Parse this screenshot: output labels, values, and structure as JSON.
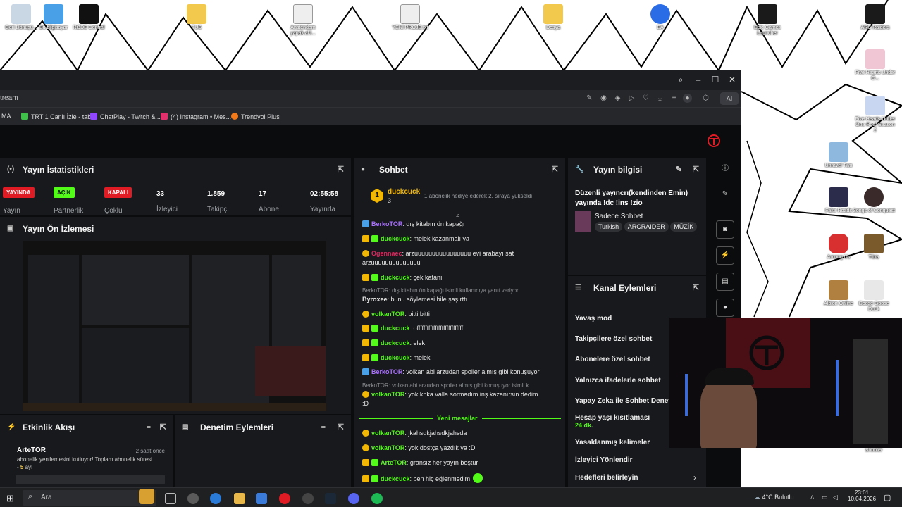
{
  "desktop": {
    "icons": [
      {
        "label": "Geri Dönüşü...",
        "color": "#c9d6e3"
      },
      {
        "label": "Bu bilgisayar",
        "color": "#4aa0e6"
      },
      {
        "label": "RØDE Central",
        "color": "#111111"
      },
      {
        "label": "TUS",
        "color": "#f2c94c"
      },
      {
        "label": "Anstendam yapak.akl...",
        "color": "#eeeeee"
      },
      {
        "label": "YENİ PROJE.txt",
        "color": "#eeeeee"
      },
      {
        "label": "Dosya",
        "color": "#f2c94c"
      },
      {
        "label": "EA",
        "color": "#2a6ce6"
      },
      {
        "label": "Epic Games Launcher",
        "color": "#1a1a1a"
      },
      {
        "label": "ARC Raiders",
        "color": "#1a1a1a"
      },
      {
        "label": "Five Hearts Under O...",
        "color": "#f1c6d4"
      },
      {
        "label": "Five Hearts Under One Roof Season 2",
        "color": "#c9d6f1"
      },
      {
        "label": "Unravel Two",
        "color": "#8fb8de"
      },
      {
        "label": "Fake Roads",
        "color": "#2b2b4b"
      },
      {
        "label": "Songs of Conquest",
        "color": "#3b2a2a"
      },
      {
        "label": "Among Us",
        "color": "#d83030"
      },
      {
        "label": "Tibia",
        "color": "#7a5a2a"
      },
      {
        "label": "Albion Online",
        "color": "#b08040"
      },
      {
        "label": "Goose Goose Duck",
        "color": "#e8e8e8"
      },
      {
        "label": "Shooter",
        "color": "#5a5a5a"
      }
    ]
  },
  "browser": {
    "url": "tream",
    "ai_label": "AI",
    "bookmarks": [
      {
        "label": "MA...",
        "color": "#888888"
      },
      {
        "label": "TRT 1 Canlı İzle - tabii",
        "color": "#3ec24a"
      },
      {
        "label": "ChatPlay - Twitch &...",
        "color": "#9146ff"
      },
      {
        "label": "(4) Instagram • Mes...",
        "color": "#e1306c"
      },
      {
        "label": "Trendyol Plus",
        "color": "#f27a1a"
      }
    ]
  },
  "stats": {
    "title": "Yayın İstatistikleri",
    "badges": [
      {
        "text": "YAYINDA",
        "bg": "#e01b24",
        "fg": "#ffffff",
        "caption": "Yayın"
      },
      {
        "text": "AÇIK",
        "bg": "#53fc18",
        "fg": "#0b0c0d",
        "caption": "Partnerlik"
      },
      {
        "text": "KAPALI",
        "bg": "#e01b24",
        "fg": "#ffffff",
        "caption": "Çoklu"
      }
    ],
    "items": [
      {
        "value": "33",
        "label": "İzleyici"
      },
      {
        "value": "1.859",
        "label": "Takipçi"
      },
      {
        "value": "17",
        "label": "Abone"
      },
      {
        "value": "02:55:58",
        "label": "Yayında"
      }
    ]
  },
  "preview": {
    "title": "Yayın Ön İzlemesi"
  },
  "activity": {
    "title": "Etkinlik Akışı",
    "item": {
      "user": "ArteTOR",
      "time": "2 saat önce",
      "text1": "abonelik yenilemesini kutluyor! Toplam abonelik süresi",
      "text2_a": "- ",
      "text2_num": "5",
      "text2_b": " ay!"
    }
  },
  "moderation": {
    "title": "Denetim Eylemleri"
  },
  "chat": {
    "title": "Sohbet",
    "pinned": {
      "user": "duckcuck",
      "count": "3",
      "text": "1 abonelik hediye ederek 2. sıraya yükseldi",
      "rank": "1"
    },
    "messages": [
      {
        "user": "BerkoTOR",
        "color": "#a970ff",
        "text": ": dış kitabın ön kapağı"
      },
      {
        "user": "duckcuck",
        "color": "#53fc18",
        "text": ": melek kazanmalı ya"
      },
      {
        "user": "Ogennaec",
        "color": "#e0245e",
        "text": ": arzuuuuuuuuuuuuuuuu evi arabayı sat"
      },
      {
        "user": "",
        "color": "#e8e8e8",
        "text": "arzuuuuuuuuuuuuuu"
      },
      {
        "user": "duckcuck",
        "color": "#53fc18",
        "text": ": çek kafanı"
      },
      {
        "user": "Byroxee",
        "color": "#e8e8e8",
        "text": ": bunu söylemesi bile şaşırttı"
      },
      {
        "user": "volkanTOR",
        "color": "#53fc18",
        "text": ": bitti bitti"
      },
      {
        "user": "duckcuck",
        "color": "#53fc18",
        "text": ": offffffffffffffffffffffffffff"
      },
      {
        "user": "duckcuck",
        "color": "#53fc18",
        "text": ": elek"
      },
      {
        "user": "duckcuck",
        "color": "#53fc18",
        "text": ": melek"
      },
      {
        "user": "BerkoTOR",
        "color": "#a970ff",
        "text": ": volkan abi arzudan spoiler almış gibi konuşuyor"
      },
      {
        "user": "volkanTOR",
        "color": "#53fc18",
        "text": ": yok knka valla sormadım inş kazanırsın dedim"
      },
      {
        "user": "",
        "color": "#e8e8e8",
        "text": ":D"
      },
      {
        "user": "volkanTOR",
        "color": "#53fc18",
        "text": ": jkahsdkjahsdkjahsda"
      },
      {
        "user": "volkanTOR",
        "color": "#53fc18",
        "text": ": yok dostça yazdık ya :D"
      },
      {
        "user": "ArteTOR",
        "color": "#53fc18",
        "text": ": gransız her yayın boştur"
      },
      {
        "user": "duckcuck",
        "color": "#53fc18",
        "text": ": ben hiç eğlenmedim"
      }
    ],
    "replies": [
      "BerkoTOR: dış kitabın ön kapağı isimli kullanıcıya yanıt veriyor",
      "BerkoTOR: volkan abi arzudan spoiler almış gibi konuşuyor isimli k..."
    ],
    "new_messages": "Yeni mesajlar"
  },
  "info": {
    "title": "Yayın bilgisi",
    "stream_title": "Düzenli yayıncrı(kendinden Emin)",
    "stream_title2": "yayında !dc !ins !zio",
    "category": "Sadece Sohbet",
    "tags": [
      "Turkish",
      "ARCRAIDER",
      "MÜZİK"
    ]
  },
  "channel_actions": {
    "title": "Kanal Eylemleri",
    "items": [
      "Yavaş mod",
      "Takipçilere özel sohbet",
      "Abonelere özel sohbet",
      "Yalnızca ifadelerle sohbet",
      "Yapay Zeka ile Sohbet Denetim",
      "Hesap yaşı kısıtlaması",
      "Yasaklanmış kelimeler",
      "İzleyici Yönlendir",
      "Hedefleri belirleyin"
    ],
    "account_age_value": "24 dk."
  },
  "taskbar": {
    "search_placeholder": "Ara",
    "weather": "4°C  Bulutlu",
    "time": "23:01",
    "date": "10.04.2026"
  },
  "colors": {
    "kick_green": "#53fc18",
    "panel": "#18191c",
    "bg": "#0b0c0d"
  }
}
